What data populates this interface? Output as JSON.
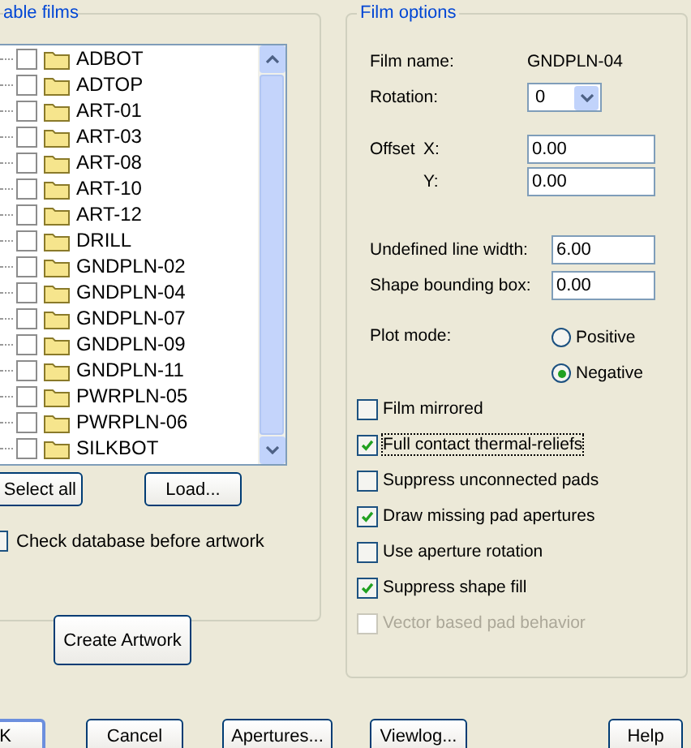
{
  "left_panel": {
    "legend": "able films",
    "films": [
      {
        "name": "ADBOT",
        "checked": false
      },
      {
        "name": "ADTOP",
        "checked": false
      },
      {
        "name": "ART-01",
        "checked": false
      },
      {
        "name": "ART-03",
        "checked": false
      },
      {
        "name": "ART-08",
        "checked": false
      },
      {
        "name": "ART-10",
        "checked": false
      },
      {
        "name": "ART-12",
        "checked": false
      },
      {
        "name": "DRILL",
        "checked": false
      },
      {
        "name": "GNDPLN-02",
        "checked": false
      },
      {
        "name": "GNDPLN-04",
        "checked": false
      },
      {
        "name": "GNDPLN-07",
        "checked": false
      },
      {
        "name": "GNDPLN-09",
        "checked": false
      },
      {
        "name": "GNDPLN-11",
        "checked": false
      },
      {
        "name": "PWRPLN-05",
        "checked": false
      },
      {
        "name": "PWRPLN-06",
        "checked": false
      },
      {
        "name": "SILKBOT",
        "checked": false
      }
    ],
    "buttons": [
      "Select all",
      "Load..."
    ],
    "check_database": {
      "label": "Check database before artwork",
      "checked": false
    },
    "create_button": "Create Artwork"
  },
  "film_options": {
    "legend": "Film options",
    "film_name": {
      "label": "Film name:",
      "value": "GNDPLN-04"
    },
    "rotation": {
      "label": "Rotation:",
      "value": "0"
    },
    "offset": {
      "label": "Offset",
      "x_label": "X:",
      "x_value": "0.00",
      "y_label": "Y:",
      "y_value": "0.00"
    },
    "line_width": {
      "label": "Undefined line width:",
      "value": "6.00"
    },
    "shape_box": {
      "label": "Shape bounding box:",
      "value": "0.00"
    },
    "plot_mode": {
      "label": "Plot mode:",
      "options": [
        {
          "label": "Positive",
          "selected": false
        },
        {
          "label": "Negative",
          "selected": true
        }
      ]
    },
    "options": [
      {
        "label": "Film mirrored",
        "checked": false,
        "disabled": false,
        "focused": false
      },
      {
        "label": "Full contact thermal-reliefs",
        "checked": true,
        "disabled": false,
        "focused": true
      },
      {
        "label": "Suppress unconnected pads",
        "checked": false,
        "disabled": false,
        "focused": false
      },
      {
        "label": "Draw missing pad apertures",
        "checked": true,
        "disabled": false,
        "focused": false
      },
      {
        "label": "Use aperture rotation",
        "checked": false,
        "disabled": false,
        "focused": false
      },
      {
        "label": "Suppress shape fill",
        "checked": true,
        "disabled": false,
        "focused": false
      },
      {
        "label": "Vector based pad behavior",
        "checked": false,
        "disabled": true,
        "focused": false
      }
    ]
  },
  "buttons": [
    {
      "label": "K",
      "default": true
    },
    {
      "label": "Cancel",
      "default": false
    },
    {
      "label": "Apertures...",
      "default": false
    },
    {
      "label": "Viewlog...",
      "default": false
    },
    {
      "label": "Help",
      "default": false
    }
  ]
}
